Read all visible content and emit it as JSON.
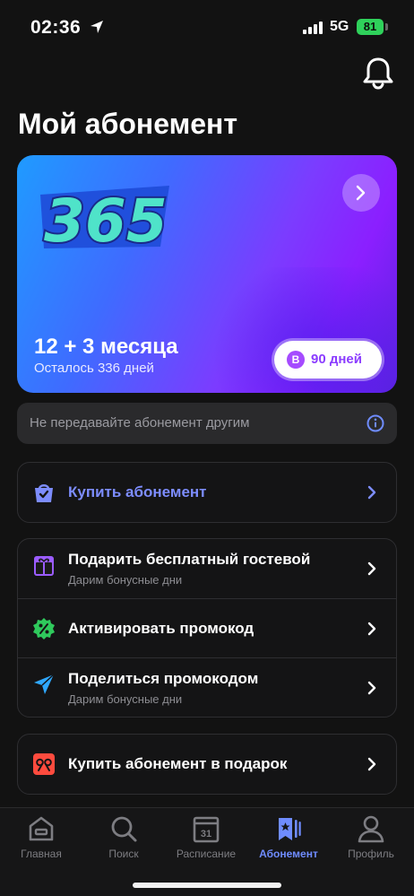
{
  "status_bar": {
    "time": "02:36",
    "network": "5G",
    "battery": "81"
  },
  "page": {
    "title": "Мой абонемент"
  },
  "subscription_card": {
    "plan_title": "12 + 3 месяца",
    "remaining": "Осталось 336 дней",
    "badge_letter": "B",
    "days_badge": "90 дней",
    "colors": {
      "start": "#1f9bff",
      "mid": "#7b3cff",
      "end": "#5b22e0"
    }
  },
  "notice": {
    "text": "Не передавайте абонемент другим"
  },
  "menu": {
    "buy": {
      "label": "Купить абонемент"
    },
    "gift_guest": {
      "label": "Подарить бесплатный гостевой",
      "sub": "Дарим бонусные дни"
    },
    "activate_promo": {
      "label": "Активировать промокод"
    },
    "share_promo": {
      "label": "Поделиться промокодом",
      "sub": "Дарим бонусные дни"
    },
    "buy_gift": {
      "label": "Купить абонемент в подарок"
    }
  },
  "tabs": [
    {
      "label": "Главная",
      "icon": "home-icon",
      "active": false
    },
    {
      "label": "Поиск",
      "icon": "search-icon",
      "active": false
    },
    {
      "label": "Расписание",
      "icon": "calendar-icon",
      "active": false,
      "day": "31"
    },
    {
      "label": "Абонемент",
      "icon": "subscription-icon",
      "active": true
    },
    {
      "label": "Профиль",
      "icon": "profile-icon",
      "active": false
    }
  ],
  "colors": {
    "accent": "#6f8cff",
    "background": "#121212"
  }
}
